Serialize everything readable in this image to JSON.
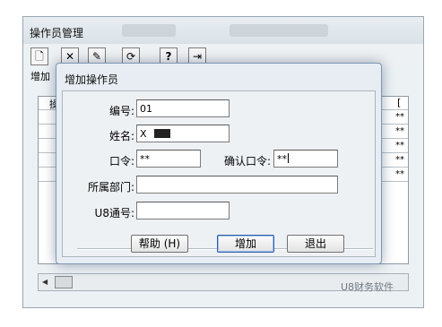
{
  "parent": {
    "title": "操作员管理",
    "toolbar": {
      "add_label": "增加",
      "icons": [
        "new-icon",
        "delete-icon",
        "edit-icon",
        "refresh-icon",
        "help-icon",
        "exit-icon"
      ]
    },
    "grid": {
      "column_header_fragments": [
        "操",
        "["
      ],
      "rows": [
        {
          "marker": "**"
        },
        {
          "marker": "**"
        },
        {
          "marker": "**"
        },
        {
          "marker": "**"
        },
        {
          "marker": "**"
        }
      ]
    }
  },
  "dialog": {
    "title": "增加操作员",
    "fields": {
      "id_label": "编号:",
      "id_value": "01",
      "name_label": "姓名:",
      "name_value": "X",
      "password_label": "口令:",
      "password_value": "**",
      "confirm_label": "确认口令:",
      "confirm_value": "**",
      "department_label": "所属部门:",
      "department_value": "",
      "u8_label": "U8通号:",
      "u8_value": ""
    },
    "buttons": {
      "help": "帮助 (H)",
      "add": "增加",
      "exit": "退出"
    }
  },
  "watermark": "U8财务软件"
}
